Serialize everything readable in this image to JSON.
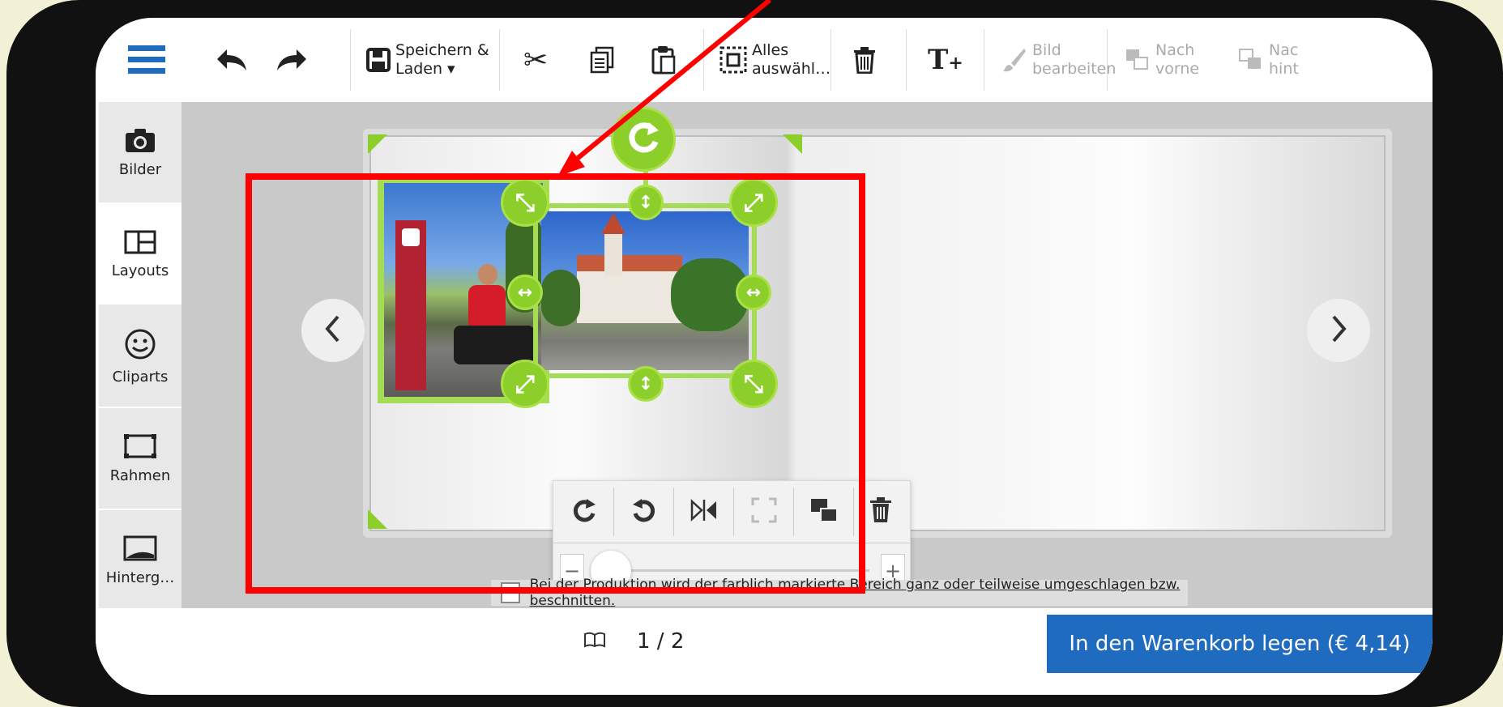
{
  "toolbar": {
    "save_label_1": "Speichern &",
    "save_label_2": "Laden ▾",
    "select_all_1": "Alles",
    "select_all_2": "auswähl…",
    "edit_image_1": "Bild",
    "edit_image_2": "bearbeiten",
    "to_front_1": "Nach",
    "to_front_2": "vorne",
    "to_back_1": "Nac",
    "to_back_2": "hint"
  },
  "sidebar": {
    "items": [
      {
        "label": "Bilder",
        "icon": "camera-icon"
      },
      {
        "label": "Layouts",
        "icon": "layouts-icon"
      },
      {
        "label": "Cliparts",
        "icon": "smiley-icon"
      },
      {
        "label": "Rahmen",
        "icon": "frame-icon"
      },
      {
        "label": "Hinterg…",
        "icon": "background-icon"
      }
    ]
  },
  "canvas": {
    "notice": "Bei der Produktion wird der farblich markierte Bereich ganz oder teilweise umgeschlagen bzw. beschnitten."
  },
  "bottom": {
    "page_indicator": "1 / 2",
    "cart_button": "In den Warenkorb legen (€ 4,14)"
  },
  "colors": {
    "accent_green": "#8ccf2a",
    "cart_blue": "#1e6bbf",
    "highlight_red": "#ff0000",
    "menu_blue": "#1e6bbf"
  }
}
